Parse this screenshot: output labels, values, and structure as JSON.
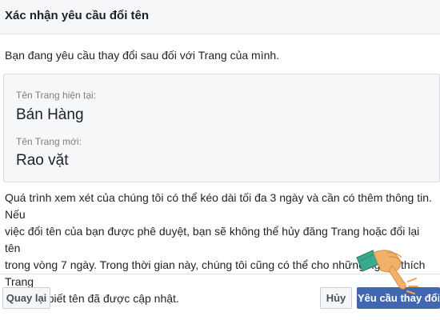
{
  "dialog": {
    "title": "Xác nhận yêu cầu đổi tên",
    "intro": "Bạn đang yêu cầu thay đổi sau đối với Trang của mình.",
    "current_name_label": "Tên Trang hiện tại:",
    "current_name": "Bán Hàng",
    "new_name_label": "Tên Trang mới:",
    "new_name": "Rao vặt",
    "notice_lines": [
      "Quá trình xem xét của chúng tôi có thể kéo dài tối đa 3 ngày và cần có thêm thông tin. Nếu",
      "việc đổi tên của bạn được phê duyệt, bạn sẽ không thể hủy đăng Trang hoặc đổi lại tên",
      "trong vòng 7 ngày. Trong thời gian này, chúng tôi cũng có thể cho những người thích Trang",
      "của bạn biết tên đã được cập nhật."
    ]
  },
  "buttons": {
    "back_label": "Quay lại",
    "cancel_label": "Hủy",
    "confirm_label": "Yêu cầu thay đổi"
  },
  "colors": {
    "accent": "#4267b2",
    "header_bg": "#f5f6f7",
    "box_bg": "#f6f7f9"
  },
  "icons": {
    "pointer": "pointing-hand-icon"
  }
}
